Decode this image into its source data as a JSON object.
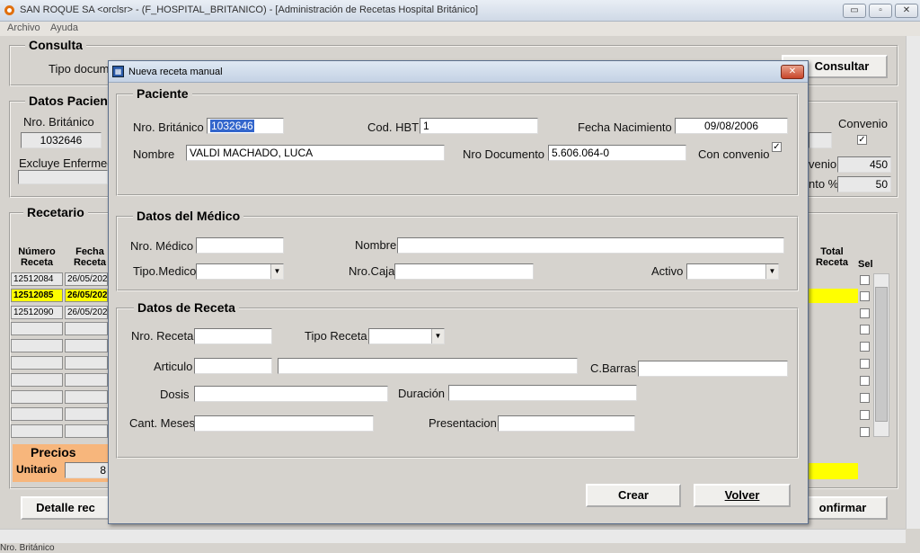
{
  "window": {
    "title": "SAN ROQUE SA <orclsr> - (F_HOSPITAL_BRITANICO) - [Administración de Recetas Hospital Británico]",
    "icon": "app-icon",
    "minimize": "▭",
    "restore": "▫",
    "close": "✕"
  },
  "menu": {
    "items": [
      "Archivo",
      "Ayuda"
    ]
  },
  "consulta": {
    "legend": "Consulta",
    "tipo_label": "Tipo docum",
    "consultar_button": "Consultar"
  },
  "datos_paciente": {
    "legend": "Datos Pacien",
    "nro_label": "Nro. Británico",
    "nro_value": "1032646",
    "excluye_label": "Excluye Enfermed",
    "convenio_label": "Convenio",
    "convenio_checked": true,
    "field1_label": "venio",
    "field1_value": "450",
    "field2_label": "nto %",
    "field2_value": "50"
  },
  "recetario": {
    "legend": "Recetario",
    "col_numero": "Número Receta",
    "col_fecha": "Fecha Receta",
    "col_total": "Total Receta",
    "col_sel": "Sel",
    "rows": [
      {
        "numero": "12512084",
        "fecha": "26/05/202",
        "selected": false
      },
      {
        "numero": "12512085",
        "fecha": "26/05/202",
        "selected": true
      },
      {
        "numero": "12512090",
        "fecha": "26/05/202",
        "selected": false
      }
    ]
  },
  "precios": {
    "legend": "Precios",
    "unitario_label": "Unitario",
    "unitario_value": "8"
  },
  "bottom_buttons": {
    "detalle": "Detalle rec",
    "confirmar": "onfirmar"
  },
  "status_text": "Nro. Británico",
  "dialog": {
    "title": "Nueva receta manual",
    "close": "✕",
    "paciente": {
      "legend": "Paciente",
      "nro_label": "Nro. Británico",
      "nro_value": "1032646",
      "cod_label": "Cod. HBT",
      "cod_value": "1",
      "fecha_label": "Fecha Nacimiento",
      "fecha_value": "09/08/2006",
      "nombre_label": "Nombre",
      "nombre_value": "VALDI MACHADO, LUCA",
      "doc_label": "Nro Documento",
      "doc_value": "5.606.064-0",
      "convenio_label": "Con convenio",
      "convenio_checked": true
    },
    "medico": {
      "legend": "Datos del Médico",
      "nro_label": "Nro. Médico",
      "nombre_label": "Nombre",
      "tipo_label": "Tipo.Medico",
      "caja_label": "Nro.Caja",
      "activo_label": "Activo"
    },
    "receta": {
      "legend": "Datos de Receta",
      "nro_label": "Nro. Receta",
      "tipo_label": "Tipo Receta",
      "articulo_label": "Articulo",
      "cbarras_label": "C.Barras",
      "dosis_label": "Dosis",
      "duracion_label": "Duración",
      "meses_label": "Cant. Meses",
      "presentacion_label": "Presentacion"
    },
    "crear_button": "Crear",
    "volver_button": "Volver"
  }
}
